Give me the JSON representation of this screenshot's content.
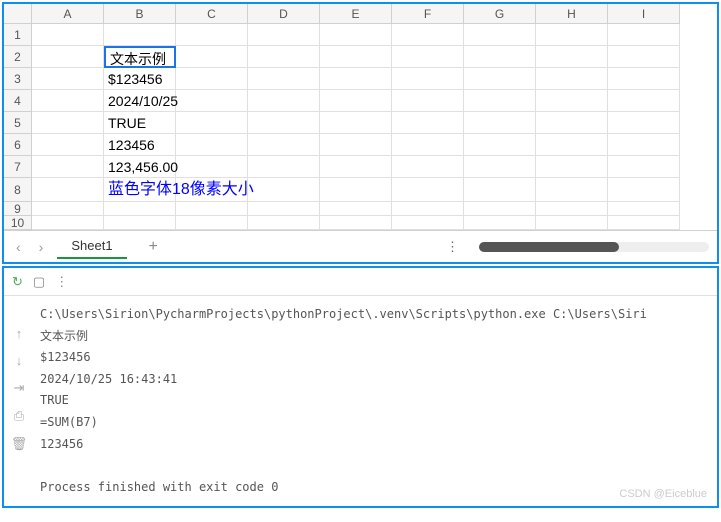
{
  "spreadsheet": {
    "columns": [
      "A",
      "B",
      "C",
      "D",
      "E",
      "F",
      "G",
      "H",
      "I"
    ],
    "rows": [
      "1",
      "2",
      "3",
      "4",
      "5",
      "6",
      "7",
      "8",
      "9",
      "10"
    ],
    "selected": "B2",
    "cells": {
      "B2": "文本示例",
      "B3": "$123456",
      "B4": "2024/10/25",
      "B5": "TRUE",
      "B6": "123456",
      "B7": "123,456.00",
      "B8": "蓝色字体18像素大小"
    },
    "tab": "Sheet1"
  },
  "terminal": {
    "lines": [
      "C:\\Users\\Sirion\\PycharmProjects\\pythonProject\\.venv\\Scripts\\python.exe C:\\Users\\Siri",
      "文本示例",
      "$123456",
      "2024/10/25 16:43:41",
      "TRUE",
      "=SUM(B7)",
      "123456",
      "",
      "Process finished with exit code 0"
    ]
  },
  "watermark": "CSDN @Eiceblue"
}
